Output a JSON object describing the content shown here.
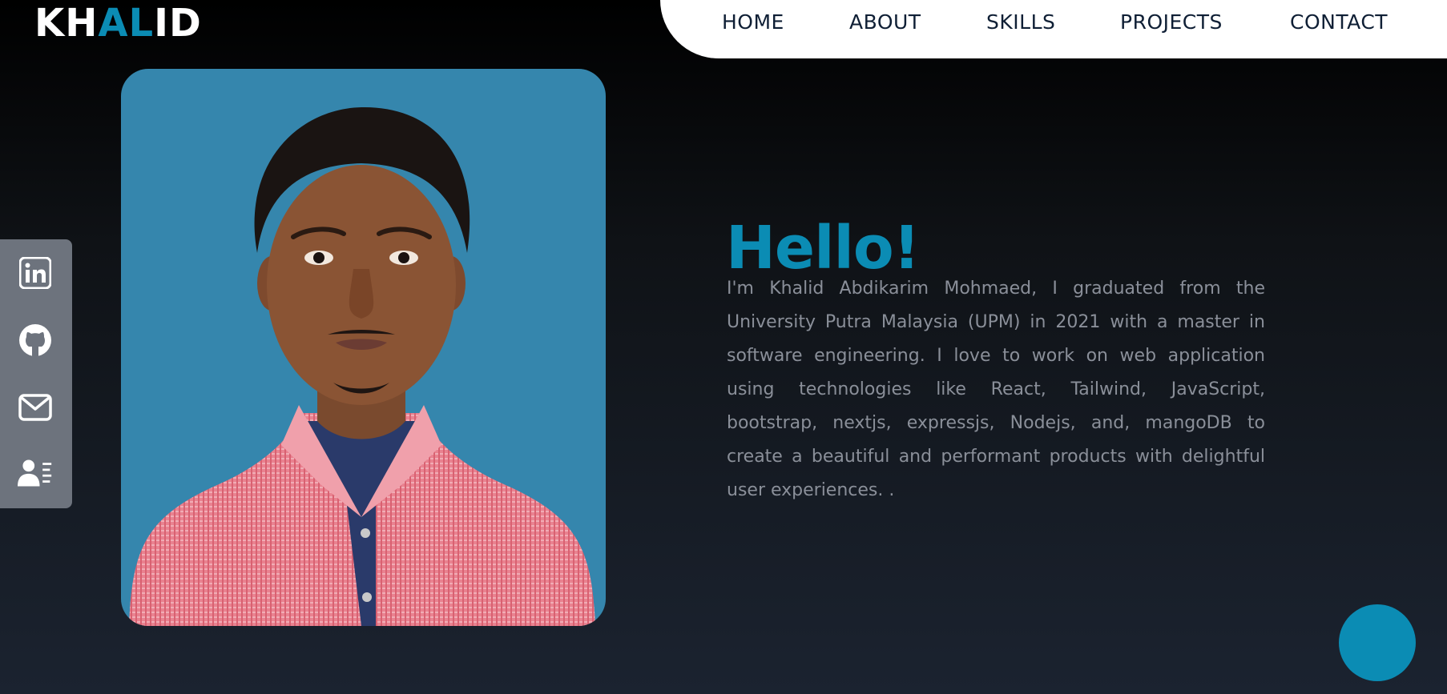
{
  "logo": {
    "part1": "KH",
    "part2": "AL",
    "part3": "ID"
  },
  "nav": {
    "items": [
      {
        "label": "HOME"
      },
      {
        "label": "ABOUT"
      },
      {
        "label": "SKILLS"
      },
      {
        "label": "PROJECTS"
      },
      {
        "label": "CONTACT"
      }
    ]
  },
  "social": {
    "icons": [
      "linkedin-icon",
      "github-icon",
      "mail-icon",
      "resume-icon"
    ]
  },
  "hero": {
    "greeting": "Hello!",
    "about": "I'm Khalid Abdikarim Mohmaed, I graduated from the University Putra Malaysia (UPM) in 2021 with a master in software engineering. I love to work on web application using technologies like React, Tailwind, JavaScript, bootstrap, nextjs, expressjs, Nodejs, and, mangoDB to create a beautiful and performant products with delightful user experiences. ."
  },
  "colors": {
    "accent": "#0b8cb4",
    "nav_bg": "#ffffff",
    "sidebar_bg": "#6d737d",
    "photo_bg": "#3586ad",
    "body_text": "#8a8f99"
  }
}
